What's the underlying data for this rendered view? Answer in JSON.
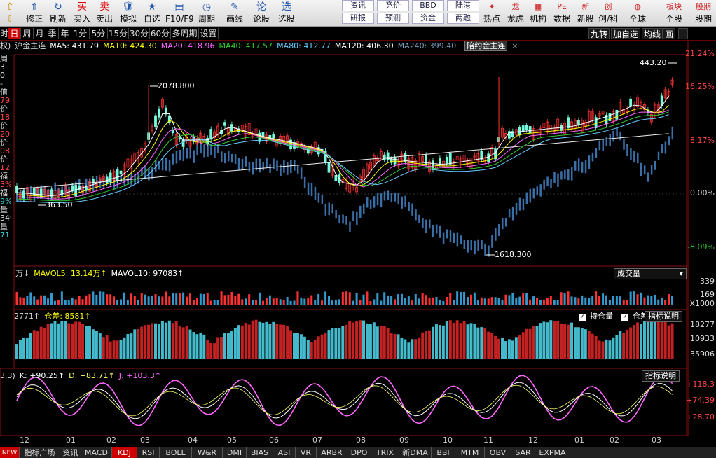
{
  "toolbar": {
    "buttons": [
      {
        "label": "修正",
        "icon": "⇑"
      },
      {
        "label": "刷新",
        "icon": "↻"
      },
      {
        "label": "买入",
        "icon": "买"
      },
      {
        "label": "卖出",
        "icon": "卖"
      },
      {
        "label": "模拟",
        "icon": "🛡"
      },
      {
        "label": "自选",
        "icon": "★"
      },
      {
        "label": "F10/F9",
        "icon": "▤"
      },
      {
        "label": "周期",
        "icon": "◷"
      },
      {
        "label": "画线",
        "icon": "✎"
      },
      {
        "label": "论股",
        "icon": "论"
      },
      {
        "label": "选股",
        "icon": "选"
      }
    ],
    "squares": [
      {
        "top": "资讯",
        "bottom": "研报"
      },
      {
        "top": "竞价",
        "bottom": "预测"
      },
      {
        "top": "BBD",
        "bottom": "资金"
      },
      {
        "top": "陆港",
        "bottom": "两融"
      }
    ],
    "right_buttons": [
      {
        "label": "热点",
        "icon": "✦"
      },
      {
        "label": "龙虎",
        "icon": "龙"
      },
      {
        "label": "机构",
        "icon": "▦"
      },
      {
        "label": "数据",
        "icon": "PE"
      },
      {
        "label": "新股",
        "icon": "新"
      },
      {
        "label": "创/科",
        "icon": "创"
      },
      {
        "label": "全球",
        "icon": "◍"
      },
      {
        "label": "个股",
        "icon": "板块"
      },
      {
        "label": "股期",
        "icon": "股期"
      }
    ]
  },
  "period_bar": {
    "items": [
      "时",
      "日",
      "周",
      "月",
      "季",
      "年",
      "1分",
      "5分",
      "15分",
      "30分",
      "60分",
      "多周期",
      "设置"
    ],
    "active": "日",
    "right": [
      "九转",
      "加自选",
      "均线",
      "画"
    ]
  },
  "main_legend": {
    "prefix": "权)",
    "name": "沪金主连",
    "ma": [
      {
        "label": "MA5: 431.79",
        "color": "#ffffff"
      },
      {
        "label": "MA10: 424.30",
        "color": "#ffff00"
      },
      {
        "label": "MA20: 418.96",
        "color": "#ff66ff"
      },
      {
        "label": "MA40: 417.57",
        "color": "#33cc33"
      },
      {
        "label": "MA80: 412.77",
        "color": "#66ccff"
      },
      {
        "label": "MA120: 406.30",
        "color": "#ffffff"
      },
      {
        "label": "MA240: 399.40",
        "color": "#7799bb"
      }
    ],
    "contract": "陪约金主连",
    "close_icon": "×"
  },
  "price_axis": [
    "21.24%",
    "16.25%",
    "8.17%",
    "0.00%",
    "-8.09%"
  ],
  "price_annotations": {
    "high_left": "2078.800",
    "low_left": "363.50",
    "low_mid": "1618.300",
    "high_right": "443.20"
  },
  "left_panel": [
    "周",
    "3",
    "0",
    "-",
    "值",
    "79",
    "价",
    "18",
    "价",
    "20",
    "价",
    "08",
    "价",
    "12",
    "福",
    "3%",
    "福",
    "9%",
    "量",
    "349",
    "量",
    "71"
  ],
  "volume": {
    "legend_prefix": "万↓",
    "mavol5": "MAVOL5: 13.14万↑",
    "mavol10": "MAVOL10: 97083↑",
    "selector": "成交量",
    "axis": [
      "339",
      "169",
      "X1000"
    ]
  },
  "oi": {
    "legend_left": "2771↑",
    "legend_pos": "仓差: 8581↑",
    "check1": "持仓量",
    "check2": "仓差",
    "help": "指标说明",
    "axis": [
      "18277",
      "10933",
      "35906"
    ]
  },
  "kdj": {
    "legend_prefix": "3,3)",
    "k": "K: +90.25↑",
    "d": "D: +83.71↑",
    "j": "J: +103.3↑",
    "help": "指标说明",
    "axis": [
      "+118.3",
      "+74.39",
      "+28.70"
    ]
  },
  "months": [
    "12",
    "01",
    "02",
    "03",
    "04",
    "05",
    "06",
    "07",
    "08",
    "09",
    "10",
    "11",
    "12",
    "01",
    "02",
    "03"
  ],
  "tabs": [
    "NEW",
    "指标广场",
    "资讯",
    "MACD",
    "KDJ",
    "RSI",
    "BOLL",
    "W&R",
    "DMI",
    "BIAS",
    "ASI",
    "VR",
    "ARBR",
    "DPO",
    "TRIX",
    "新DMA",
    "BBI",
    "MTM",
    "OBV",
    "SAR",
    "EXPMA"
  ],
  "active_tab": "KDJ",
  "colors": {
    "up": "#ff3333",
    "down": "#3a6fa8",
    "ma_white": "#ffffff",
    "ma_yellow": "#ffff00",
    "ma_pink": "#ff66ff",
    "ma_green": "#33cc33",
    "ma_cyan": "#66ccff",
    "oi_red": "#c22222",
    "oi_cyan": "#44bbcc",
    "kdj_k": "#ffffff",
    "kdj_d": "#ffff66",
    "kdj_j": "#ff66ff"
  }
}
